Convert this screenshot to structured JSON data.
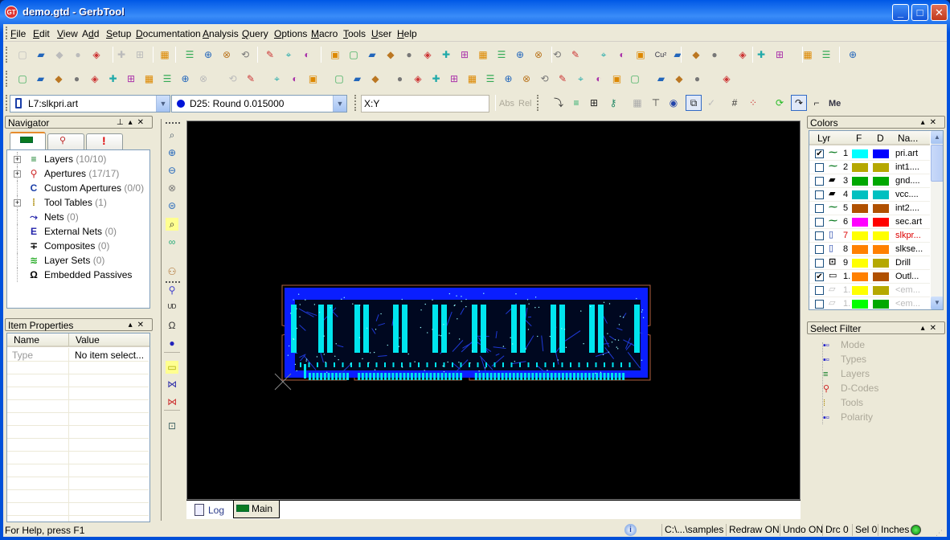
{
  "window": {
    "title": "demo.gtd - GerbTool",
    "app_icon": "GT",
    "controls": [
      "minimize",
      "maximize",
      "close"
    ]
  },
  "menu": [
    "File",
    "Edit",
    "View",
    "Add",
    "Setup",
    "Documentation",
    "Analysis",
    "Query",
    "Options",
    "Macro",
    "Tools",
    "User",
    "Help"
  ],
  "menu_mnemonics": [
    "F",
    "E",
    "V",
    "d",
    "S",
    "D",
    "A",
    "Q",
    "O",
    "M",
    "T",
    "U",
    "H"
  ],
  "toolbar1": [
    "new",
    "open",
    "save",
    "print",
    "import",
    "copy",
    "paste",
    "help",
    "layers",
    "new-layer",
    "panel-view",
    "query-window",
    "align",
    "stack",
    "layer-set",
    "palette",
    "grid-palette",
    "snowman",
    "probe",
    "dots",
    "net-connect",
    "net-delete",
    "pattern",
    "connect",
    "disconnect",
    "net-route",
    "net-list",
    "drc",
    "netlist",
    "magnify",
    "document",
    "net-highlight",
    "cu-area",
    "zoom-top",
    "expand",
    "collapse",
    "edge",
    "edge-remove",
    "insert-top",
    "insert-bottom",
    "flip",
    "convert"
  ],
  "toolbar1_labels": {
    "cu": "Cu²"
  },
  "toolbar2": [
    "add-pad",
    "add-line",
    "add-rect",
    "add-circle",
    "add-arc",
    "add-move",
    "add-array",
    "add-stamp",
    "add-text",
    "add-mirror",
    "undo",
    "redo",
    "join",
    "split",
    "delete",
    "mirror-x",
    "mirror-both",
    "cross-delete",
    "text",
    "text-box",
    "rotate",
    "swap",
    "origin",
    "datum",
    "fillet",
    "corner",
    "rect-select",
    "move-pad",
    "connect-pad",
    "pad-pad",
    "cursor-drag",
    "properties",
    "new-box",
    "add-box",
    "remove-box",
    "delete-box",
    "box"
  ],
  "toolbar3": {
    "layer_select": "L7:slkpri.art",
    "dcode_select": "D25: Round 0.015000",
    "coord_input": "X:Y",
    "abs_label": "Abs",
    "rel_label": "Rel",
    "me_label": "Me"
  },
  "navigator": {
    "title": "Navigator",
    "tabs": [
      "board",
      "errors",
      "alerts"
    ],
    "items": [
      {
        "label": "Layers",
        "count": "(10/10)",
        "expandable": true,
        "icon": "layers-icon"
      },
      {
        "label": "Apertures",
        "count": "(17/17)",
        "expandable": true,
        "icon": "apertures-icon"
      },
      {
        "label": "Custom Apertures",
        "count": "(0/0)",
        "expandable": false,
        "icon": "custom-aperture-icon"
      },
      {
        "label": "Tool Tables",
        "count": "(1)",
        "expandable": true,
        "icon": "tool-icon"
      },
      {
        "label": "Nets",
        "count": "(0)",
        "expandable": false,
        "icon": "nets-icon"
      },
      {
        "label": "External Nets",
        "count": "(0)",
        "expandable": false,
        "icon": "external-nets-icon"
      },
      {
        "label": "Composites",
        "count": "(0)",
        "expandable": false,
        "icon": "composites-icon"
      },
      {
        "label": "Layer Sets",
        "count": "(0)",
        "expandable": false,
        "icon": "layer-sets-icon"
      },
      {
        "label": "Embedded Passives",
        "count": "",
        "expandable": false,
        "icon": "omega-icon"
      }
    ]
  },
  "item_properties": {
    "title": "Item Properties",
    "columns": [
      "Name",
      "Value"
    ],
    "rows": [
      {
        "name": "Type",
        "value": "No item select..."
      }
    ]
  },
  "colors_panel": {
    "title": "Colors",
    "columns": [
      "Lyr",
      "F",
      "D",
      "Na..."
    ],
    "rows": [
      {
        "checked": true,
        "num": "1",
        "f": "#00ffff",
        "d": "#0000ff",
        "name": "pri.art",
        "icon": "trace",
        "highlight": false,
        "dim": false
      },
      {
        "checked": false,
        "num": "2",
        "f": "#b5a800",
        "d": "#b5a800",
        "name": "int1....",
        "icon": "trace",
        "highlight": false,
        "dim": false
      },
      {
        "checked": false,
        "num": "3",
        "f": "#00a800",
        "d": "#00a800",
        "name": "gnd....",
        "icon": "plane",
        "highlight": false,
        "dim": false
      },
      {
        "checked": false,
        "num": "4",
        "f": "#00c0c0",
        "d": "#00c0c0",
        "name": "vcc....",
        "icon": "plane",
        "highlight": false,
        "dim": false
      },
      {
        "checked": false,
        "num": "5",
        "f": "#b05000",
        "d": "#b05000",
        "name": "int2....",
        "icon": "trace",
        "highlight": false,
        "dim": false
      },
      {
        "checked": false,
        "num": "6",
        "f": "#ff00ff",
        "d": "#ff0000",
        "name": "sec.art",
        "icon": "trace",
        "highlight": false,
        "dim": false
      },
      {
        "checked": false,
        "num": "7",
        "f": "#ffff00",
        "d": "#ffff00",
        "name": "slkpr...",
        "icon": "silk",
        "highlight": true,
        "dim": false
      },
      {
        "checked": false,
        "num": "8",
        "f": "#ff8000",
        "d": "#ff8000",
        "name": "slkse...",
        "icon": "silk",
        "highlight": false,
        "dim": false
      },
      {
        "checked": false,
        "num": "9",
        "f": "#ffff00",
        "d": "#b5a800",
        "name": "Drill",
        "icon": "drill",
        "highlight": false,
        "dim": false
      },
      {
        "checked": true,
        "num": "1.",
        "f": "#ff8000",
        "d": "#b05000",
        "name": "Outl...",
        "icon": "outline",
        "highlight": false,
        "dim": false
      },
      {
        "checked": false,
        "num": "1.",
        "f": "#ffff00",
        "d": "#b5a800",
        "name": "<em...",
        "icon": "empty",
        "highlight": false,
        "dim": true
      },
      {
        "checked": false,
        "num": "1.",
        "f": "#00ff00",
        "d": "#00a800",
        "name": "<em...",
        "icon": "empty",
        "highlight": false,
        "dim": true
      }
    ]
  },
  "select_filter": {
    "title": "Select Filter",
    "items": [
      {
        "label": "Mode",
        "icon": "tree-icon"
      },
      {
        "label": "Types",
        "icon": "tree-icon"
      },
      {
        "label": "Layers",
        "icon": "layers-icon"
      },
      {
        "label": "D-Codes",
        "icon": "apertures-icon"
      },
      {
        "label": "Tools",
        "icon": "tool-icon"
      },
      {
        "label": "Polarity",
        "icon": "tree-icon"
      }
    ]
  },
  "view_toolbar": [
    "zoom-window",
    "zoom-in",
    "zoom-out",
    "zoom-fit",
    "zoom-extents",
    "zoom-previous",
    "view-glasses",
    "find",
    "net-find",
    "ud",
    "omega-query",
    "highlight",
    "ruler",
    "measure-blue",
    "measure-red",
    "dimension"
  ],
  "bottom_tabs": [
    {
      "label": "Log",
      "active": false
    },
    {
      "label": "Main",
      "active": true
    }
  ],
  "statusbar": {
    "help": "For Help, press F1",
    "path": "C:\\...\\samples",
    "redraw": "Redraw ON",
    "undo": "Undo ON",
    "drc": "Drc 0",
    "sel": "Sel 0",
    "units": "Inches"
  },
  "colors": {
    "canvas_bg": "#000000",
    "copper_fill": "#0a1eff",
    "pads": "#00e5ee",
    "outline": "#b06040"
  }
}
